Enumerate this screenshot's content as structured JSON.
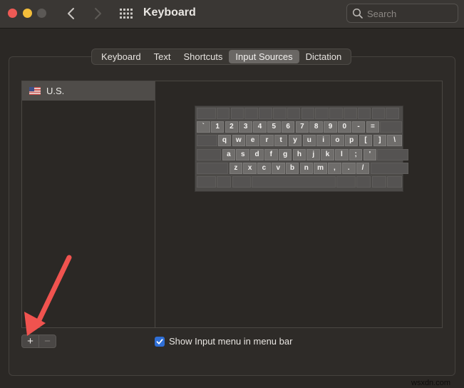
{
  "window": {
    "title": "Keyboard",
    "traffic_lights": [
      "close",
      "minimize",
      "zoom-disabled"
    ],
    "nav": {
      "back_icon": "chevron-left-icon",
      "forward_icon": "chevron-right-icon",
      "grid_icon": "show-all-grid-icon"
    },
    "search": {
      "placeholder": "Search",
      "value": "",
      "icon": "magnifier-icon"
    }
  },
  "tabs": [
    {
      "label": "Keyboard",
      "active": false
    },
    {
      "label": "Text",
      "active": false
    },
    {
      "label": "Shortcuts",
      "active": false
    },
    {
      "label": "Input Sources",
      "active": true
    },
    {
      "label": "Dictation",
      "active": false
    }
  ],
  "input_sources": {
    "items": [
      {
        "label": "U.S.",
        "flag": "us-flag-icon",
        "selected": true
      }
    ],
    "add_label": "+",
    "remove_label": "−"
  },
  "keyboard_layout": {
    "rows": [
      [
        "",
        "",
        "",
        "",
        "",
        "",
        "",
        "",
        "",
        "",
        "",
        "",
        "",
        ""
      ],
      [
        "`",
        "1",
        "2",
        "3",
        "4",
        "5",
        "6",
        "7",
        "8",
        "9",
        "0",
        "-",
        "=",
        ""
      ],
      [
        "",
        "q",
        "w",
        "e",
        "r",
        "t",
        "y",
        "u",
        "i",
        "o",
        "p",
        "[",
        "]",
        "\\"
      ],
      [
        "",
        "a",
        "s",
        "d",
        "f",
        "g",
        "h",
        "j",
        "k",
        "l",
        ";",
        "'",
        ""
      ],
      [
        "",
        "z",
        "x",
        "c",
        "v",
        "b",
        "n",
        "m",
        ",",
        ".",
        "/",
        ""
      ],
      [
        "",
        "",
        "",
        "",
        "",
        "",
        "",
        ""
      ]
    ]
  },
  "options": {
    "show_input_menu": {
      "label": "Show Input menu in menu bar",
      "checked": true
    }
  },
  "annotation": {
    "type": "arrow",
    "color": "#f0534f",
    "points_to": "add-button"
  },
  "watermark": "wsxdn.com",
  "colors": {
    "accent": "#2f6fd6",
    "close": "#ee5a55",
    "minimize": "#f4be3a",
    "arrow": "#f0534f"
  }
}
